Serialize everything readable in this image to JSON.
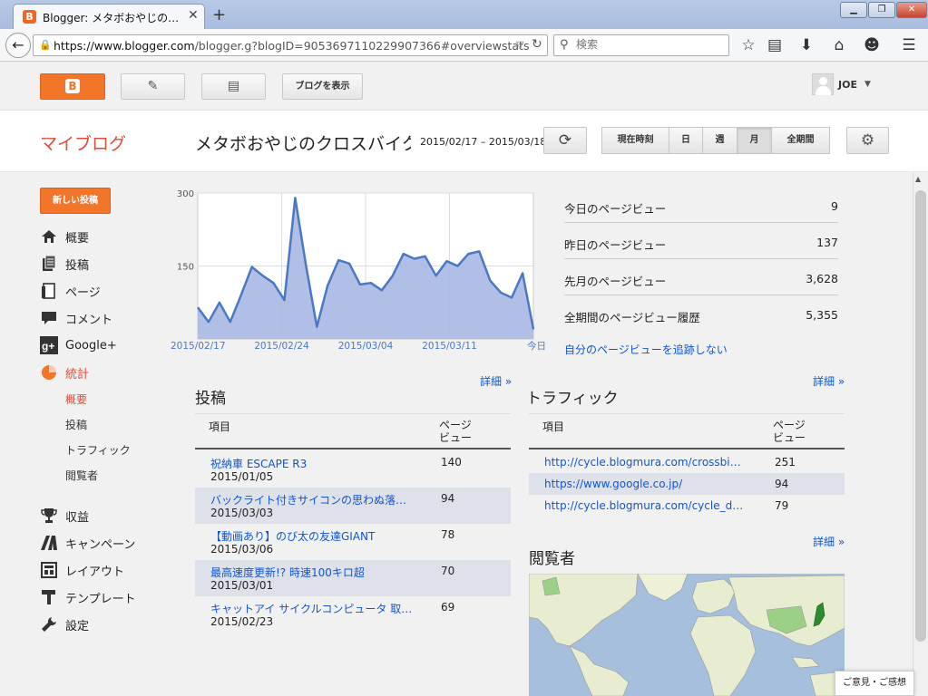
{
  "browser": {
    "tab_title": "Blogger: メタボおやじの…",
    "url_host": "https://www.blogger.com",
    "url_rest": "/blogger.g?blogID=9053697110229907366#overviewstats",
    "search_placeholder": "検索"
  },
  "header": {
    "view_blog_label": "ブログを表示",
    "username": "JOE"
  },
  "pagebar": {
    "my_blog": "マイブログ",
    "blog_title": "メタボおやじのクロスバイクな",
    "date_range": "2015/02/17 – 2015/03/18",
    "ranges": [
      "現在時刻",
      "日",
      "週",
      "月",
      "全期間"
    ],
    "active_range": "月"
  },
  "sidebar": {
    "new_post": "新しい投稿",
    "items": [
      {
        "label": "概要",
        "icon": "home-icon"
      },
      {
        "label": "投稿",
        "icon": "posts-icon"
      },
      {
        "label": "ページ",
        "icon": "pages-icon"
      },
      {
        "label": "コメント",
        "icon": "comment-icon"
      },
      {
        "label": "Google+",
        "icon": "google-plus-icon"
      },
      {
        "label": "統計",
        "icon": "stats-pie-icon"
      },
      {
        "label": "収益",
        "icon": "trophy-icon"
      },
      {
        "label": "キャンペーン",
        "icon": "campaign-icon"
      },
      {
        "label": "レイアウト",
        "icon": "layout-icon"
      },
      {
        "label": "テンプレート",
        "icon": "template-icon"
      },
      {
        "label": "設定",
        "icon": "wrench-icon"
      }
    ],
    "stats_sub": [
      "概要",
      "投稿",
      "トラフィック",
      "閲覧者"
    ]
  },
  "chart_data": {
    "type": "area",
    "x_tick_labels": [
      "2015/02/17",
      "2015/02/24",
      "2015/03/04",
      "2015/03/11",
      "今日"
    ],
    "y_ticks": [
      150,
      300
    ],
    "ylim": [
      0,
      300
    ],
    "values": [
      65,
      35,
      75,
      35,
      90,
      148,
      130,
      115,
      80,
      290,
      150,
      25,
      110,
      162,
      155,
      112,
      115,
      100,
      130,
      175,
      165,
      170,
      130,
      160,
      150,
      175,
      180,
      120,
      95,
      85,
      135,
      20
    ],
    "color": "#4a78c3",
    "fill": "#a8b8e3"
  },
  "stats": [
    {
      "label": "今日のページビュー",
      "value": "9"
    },
    {
      "label": "昨日のページビュー",
      "value": "137"
    },
    {
      "label": "先月のページビュー",
      "value": "3,628"
    },
    {
      "label": "全期間のページビュー履歴",
      "value": "5,355"
    }
  ],
  "stats_optout": "自分のページビューを追跡しない",
  "posts": {
    "title": "投稿",
    "more": "詳細 »",
    "col_item": "項目",
    "col_views": "ページ\nビュー",
    "rows": [
      {
        "title": "祝納車 ESCAPE R3",
        "date": "2015/01/05",
        "views": "140"
      },
      {
        "title": "バックライト付きサイコンの思わぬ落とし穴",
        "date": "2015/03/03",
        "views": "94"
      },
      {
        "title": "【動画あり】のび太の友達GIANT",
        "date": "2015/03/06",
        "views": "78"
      },
      {
        "title": "最高速度更新!? 時速100キロ超",
        "date": "2015/03/01",
        "views": "70"
      },
      {
        "title": "キャットアイ サイクルコンピュータ 取説…",
        "date": "2015/02/23",
        "views": "69"
      }
    ]
  },
  "traffic": {
    "title": "トラフィック",
    "more": "詳細 »",
    "col_item": "項目",
    "col_views": "ページ\nビュー",
    "rows": [
      {
        "title": "http://cycle.blogmura.com/crossbike/",
        "views": "251"
      },
      {
        "title": "https://www.google.co.jp/",
        "views": "94"
      },
      {
        "title": "http://cycle.blogmura.com/cycle_diary/",
        "views": "79"
      }
    ]
  },
  "audience": {
    "title": "閲覧者",
    "more": "詳細 »"
  },
  "feedback": "ご意見・ご感想"
}
